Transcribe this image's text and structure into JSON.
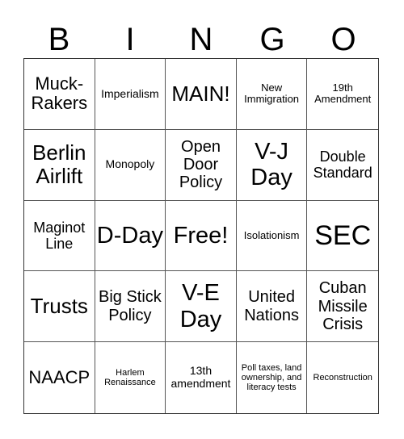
{
  "header": {
    "letters": [
      "B",
      "I",
      "N",
      "G",
      "O"
    ]
  },
  "cells": [
    "Muck-Rakers",
    "Imperialism",
    "MAIN!",
    "New Immigration",
    "19th Amendment",
    "Berlin Airlift",
    "Monopoly",
    "Open Door Policy",
    "V-J Day",
    "Double Standard",
    "Maginot Line",
    "D-Day",
    "Free!",
    "Isolationism",
    "SEC",
    "Trusts",
    "Big Stick Policy",
    "V-E Day",
    "United Nations",
    "Cuban Missile Crisis",
    "NAACP",
    "Harlem Renaissance",
    "13th amendment",
    "Poll taxes, land ownership, and literacy tests",
    "Reconstruction"
  ]
}
